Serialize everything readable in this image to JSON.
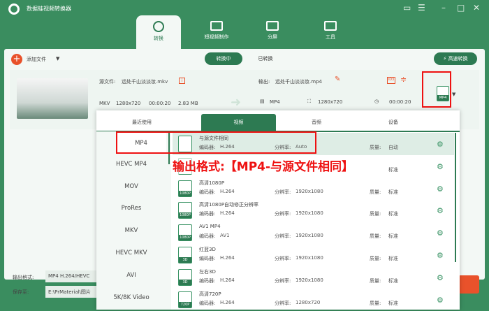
{
  "app": {
    "title": "数据蛙视频转换器"
  },
  "tabs": [
    {
      "label": "转换"
    },
    {
      "label": "短视频制作"
    },
    {
      "label": "分屏"
    },
    {
      "label": "工具"
    }
  ],
  "toolbar": {
    "add_file": "添加文件",
    "converting": "转换中",
    "converted": "已转换",
    "fast_convert": "高速转换"
  },
  "file": {
    "source_label": "源文件:",
    "source_name": "远处千山淡淡妆.mkv",
    "format": "MKV",
    "resolution": "1280x720",
    "duration": "00:00:20",
    "size": "2.83 MB",
    "output_label": "输出:",
    "output_name": "远处千山淡淡妆.mp4",
    "out_format": "MP4",
    "out_resolution": "1280x720",
    "out_duration": "00:00:20",
    "format_badge": "MP4"
  },
  "dropdown": {
    "tabs": [
      "最近使用",
      "视频",
      "音频",
      "设备"
    ],
    "formats": [
      "MP4",
      "HEVC MP4",
      "MOV",
      "ProRes",
      "MKV",
      "HEVC MKV",
      "AVI",
      "5K/8K Video"
    ],
    "labels": {
      "encoder": "编码器:",
      "resolution": "分辨率:",
      "quality": "质量:"
    },
    "presets": [
      {
        "name": "与源文件相同",
        "badge": "",
        "encoder": "H.264",
        "resolution": "Auto",
        "quality": "自动"
      },
      {
        "name": "",
        "badge": "",
        "encoder": "",
        "resolution": "",
        "quality": "标准"
      },
      {
        "name": "高清1080P",
        "badge": "1080P",
        "encoder": "H.264",
        "resolution": "1920x1080",
        "quality": "标准"
      },
      {
        "name": "高清1080P自动修正分辨率",
        "badge": "1080P",
        "encoder": "H.264",
        "resolution": "1920x1080",
        "quality": "标准"
      },
      {
        "name": "AV1 MP4",
        "badge": "1080P",
        "encoder": "AV1",
        "resolution": "1920x1080",
        "quality": "标准"
      },
      {
        "name": "红蓝3D",
        "badge": "3D",
        "encoder": "H.264",
        "resolution": "1920x1080",
        "quality": "标准"
      },
      {
        "name": "左右3D",
        "badge": "3D",
        "encoder": "H.264",
        "resolution": "1920x1080",
        "quality": "标准"
      },
      {
        "name": "高清720P",
        "badge": "720P",
        "encoder": "H.264",
        "resolution": "1280x720",
        "quality": "标准"
      }
    ]
  },
  "annotation": "输出格式:【MP4-与源文件相同】",
  "bottom": {
    "output_format_label": "输出格式:",
    "output_format_value": "MP4 H.264/HEVC",
    "save_to_label": "保存至:",
    "save_to_value": "E:\\PrMaterial\\图片"
  }
}
